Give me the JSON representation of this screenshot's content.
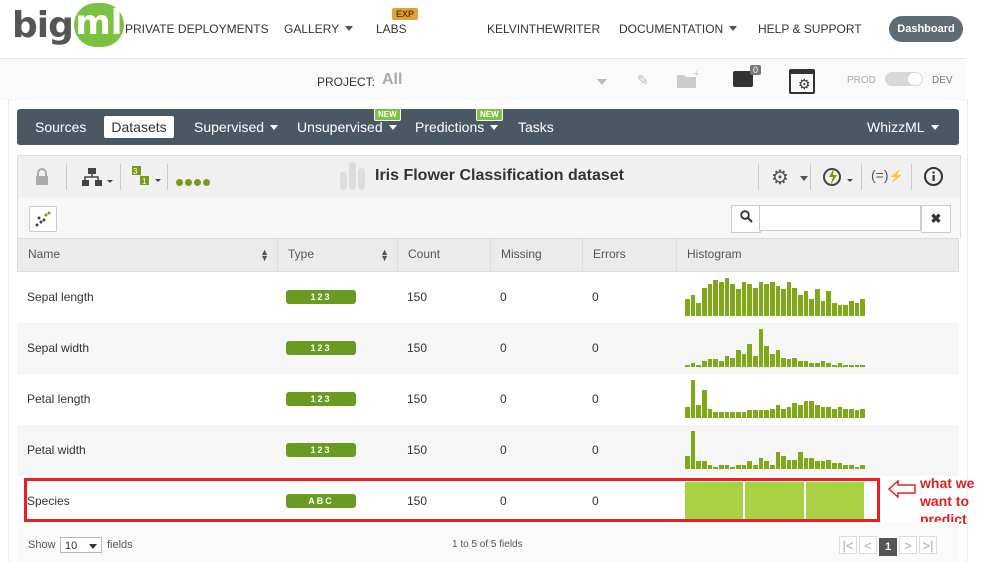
{
  "brand": {
    "big": "big",
    "ml": "ml"
  },
  "topnav": {
    "private_deployments": "PRIVATE DEPLOYMENTS",
    "gallery": "GALLERY",
    "labs": "LABS",
    "labs_badge": "EXP",
    "user": "KELVINTHEWRITER",
    "documentation": "DOCUMENTATION",
    "help": "HELP & SUPPORT",
    "dashboard": "Dashboard"
  },
  "project": {
    "label": "PROJECT:",
    "value": "All",
    "selection_count": "0",
    "prod": "PROD",
    "dev": "DEV"
  },
  "mainnav": {
    "sources": "Sources",
    "datasets": "Datasets",
    "supervised": "Supervised",
    "unsupervised": "Unsupervised",
    "predictions": "Predictions",
    "tasks": "Tasks",
    "whizzml": "WhizzML",
    "new_badge": "NEW"
  },
  "dataset": {
    "title": "Iris Flower Classification dataset"
  },
  "search": {
    "placeholder": ""
  },
  "table": {
    "headers": {
      "name": "Name",
      "type": "Type",
      "count": "Count",
      "missing": "Missing",
      "errors": "Errors",
      "histogram": "Histogram"
    },
    "rows": [
      {
        "name": "Sepal length",
        "type": "123",
        "count": "150",
        "missing": "0",
        "errors": "0"
      },
      {
        "name": "Sepal width",
        "type": "123",
        "count": "150",
        "missing": "0",
        "errors": "0"
      },
      {
        "name": "Petal length",
        "type": "123",
        "count": "150",
        "missing": "0",
        "errors": "0"
      },
      {
        "name": "Petal width",
        "type": "123",
        "count": "150",
        "missing": "0",
        "errors": "0"
      },
      {
        "name": "Species",
        "type": "ABC",
        "count": "150",
        "missing": "0",
        "errors": "0"
      }
    ],
    "histograms": [
      [
        0.45,
        0.55,
        0.35,
        0.75,
        0.85,
        0.95,
        0.9,
        1.0,
        0.85,
        0.7,
        0.9,
        0.85,
        0.75,
        0.9,
        0.85,
        0.9,
        0.8,
        0.7,
        0.9,
        0.75,
        0.55,
        0.65,
        0.45,
        0.7,
        0.4,
        0.65,
        0.35,
        0.3,
        0.3,
        0.4,
        0.35,
        0.45
      ],
      [
        0.05,
        0.1,
        0.05,
        0.15,
        0.2,
        0.2,
        0.15,
        0.3,
        0.25,
        0.45,
        0.35,
        0.6,
        0.3,
        1.0,
        0.55,
        0.35,
        0.45,
        0.25,
        0.2,
        0.25,
        0.15,
        0.15,
        0.1,
        0.1,
        0.15,
        0.1,
        0.05,
        0.1,
        0.05,
        0.05,
        0.05,
        0.05
      ],
      [
        0.3,
        1.0,
        0.35,
        0.75,
        0.25,
        0.15,
        0.15,
        0.15,
        0.15,
        0.15,
        0.15,
        0.2,
        0.2,
        0.2,
        0.2,
        0.25,
        0.35,
        0.25,
        0.3,
        0.4,
        0.35,
        0.45,
        0.45,
        0.35,
        0.3,
        0.3,
        0.25,
        0.3,
        0.25,
        0.25,
        0.2,
        0.25
      ],
      [
        0.35,
        1.0,
        0.2,
        0.2,
        0.1,
        0.05,
        0.1,
        0.1,
        0.05,
        0.1,
        0.1,
        0.2,
        0.1,
        0.3,
        0.2,
        0.1,
        0.45,
        0.35,
        0.25,
        0.25,
        0.45,
        0.3,
        0.3,
        0.2,
        0.2,
        0.25,
        0.15,
        0.15,
        0.1,
        0.1,
        0.05,
        0.1
      ],
      [
        1.0,
        1.0,
        1.0
      ]
    ]
  },
  "annotation": {
    "line1": "what we",
    "line2": "want to",
    "line3": "predict"
  },
  "footer": {
    "show": "Show",
    "per_page": "10",
    "fields": "fields",
    "range": "1 to 5 of 5 fields",
    "page": "1",
    "first": "|<",
    "prev": "<",
    "next": ">",
    "last": ">|"
  },
  "colors": {
    "brand_green": "#7cc242",
    "numeric_hist": "#7fa919",
    "categorical_hist": "#a8d146",
    "nav_bg": "#4a5863",
    "annotation_red": "#e82020"
  }
}
